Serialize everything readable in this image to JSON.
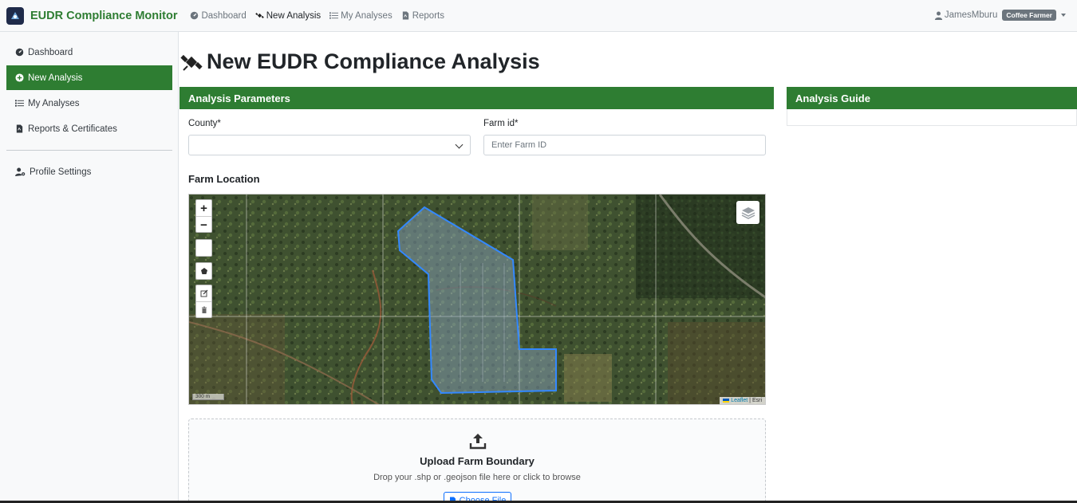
{
  "app": {
    "title": "EUDR Compliance Monitor"
  },
  "topnav": {
    "items": [
      {
        "label": "Dashboard",
        "icon": "gauge-icon"
      },
      {
        "label": "New Analysis",
        "icon": "satellite-icon",
        "active": true
      },
      {
        "label": "My Analyses",
        "icon": "list-icon"
      },
      {
        "label": "Reports",
        "icon": "file-pdf-icon"
      }
    ]
  },
  "user": {
    "name": "JamesMburu",
    "role": "Coffee Farmer"
  },
  "sidebar": {
    "items": [
      {
        "label": "Dashboard",
        "icon": "gauge-icon"
      },
      {
        "label": "New Analysis",
        "icon": "plus-circle-icon",
        "active": true
      },
      {
        "label": "My Analyses",
        "icon": "list-icon"
      },
      {
        "label": "Reports & Certificates",
        "icon": "file-pdf-icon"
      },
      {
        "label": "Profile Settings",
        "icon": "user-gear-icon"
      }
    ]
  },
  "page": {
    "title": "New EUDR Compliance Analysis"
  },
  "params": {
    "header": "Analysis Parameters",
    "county_label": "County*",
    "county_value": "",
    "farm_id_label": "Farm id*",
    "farm_id_placeholder": "Enter Farm ID",
    "farm_id_value": "",
    "location_title": "Farm Location"
  },
  "map": {
    "zoom_in": "+",
    "zoom_out": "−",
    "scale_label": "300 m",
    "attribution_link": "Leaflet",
    "attribution_sep": " | ",
    "attribution_source": "Esri",
    "tools": [
      "draw-square-icon",
      "draw-polygon-icon",
      "edit-layers-icon",
      "delete-layers-icon"
    ],
    "colors": {
      "polygon": "#3388ff"
    }
  },
  "upload": {
    "title": "Upload Farm Boundary",
    "hint": "Drop your .shp or .geojson file here or click to browse",
    "button": "Choose File"
  },
  "guide": {
    "header": "Analysis Guide"
  },
  "colors": {
    "brand": "#2e7d32",
    "primary": "#0d6efd"
  }
}
